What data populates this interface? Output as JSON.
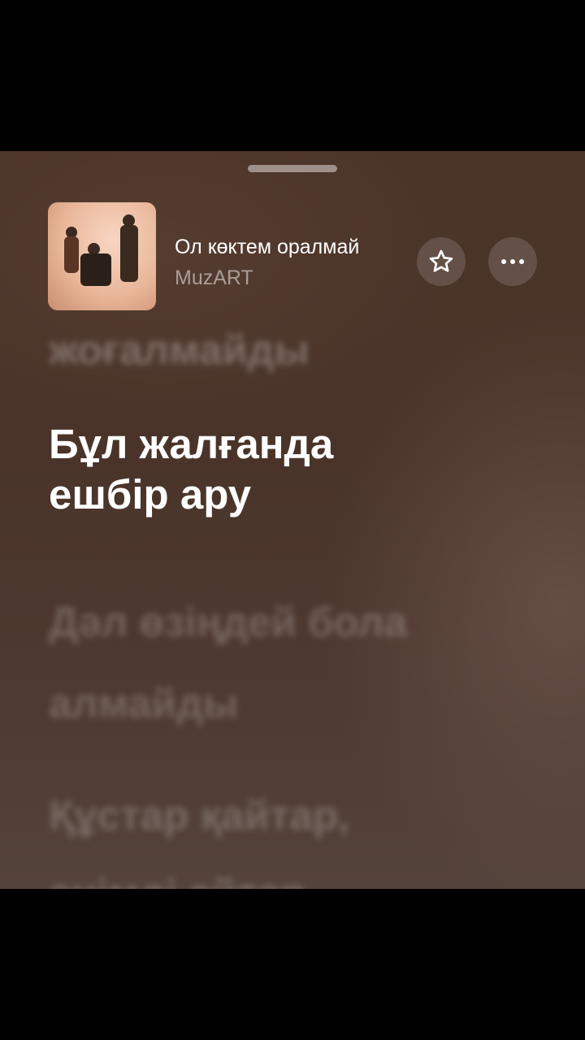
{
  "now_playing": {
    "title": "Ол көктем оралмай",
    "artist": "MuzART",
    "artwork_icon": "album-artwork"
  },
  "controls": {
    "favorite_icon": "star-icon",
    "more_icon": "ellipsis-icon"
  },
  "lyrics": {
    "previous": [
      "жоғалмайды"
    ],
    "active": [
      "Бұл жалғанда",
      "ешбір ару"
    ],
    "next": [
      "Дәл өзіңдей бола",
      "алмайды"
    ],
    "next2": [
      "Құстар қайтар,",
      "әнімді айтар"
    ]
  },
  "colors": {
    "background": "#4b3428",
    "active_lyric": "#ffffff"
  }
}
